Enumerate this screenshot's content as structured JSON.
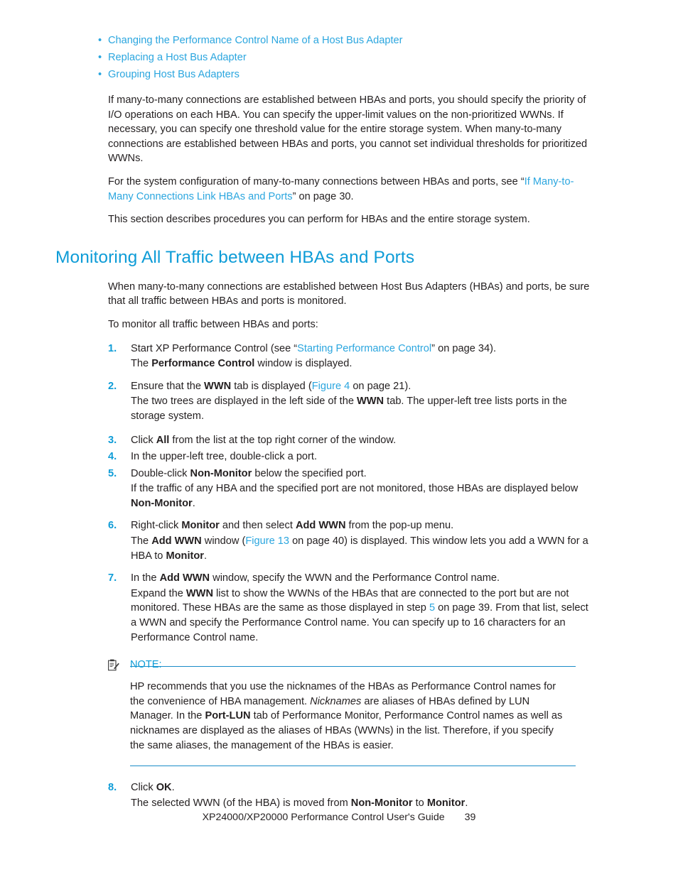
{
  "document": {
    "title": "XP24000/XP20000 Performance Control User's Guide",
    "page_number": "39"
  },
  "colors": {
    "heading_blue": "#0e9cd7",
    "link_blue": "#2ba6df",
    "rule_blue": "#1a8cc8",
    "body_black": "#231f20"
  },
  "top_links": [
    {
      "bullet": "•",
      "label": "Changing the Performance Control Name of a Host Bus Adapter"
    },
    {
      "bullet": "•",
      "label": "Replacing a Host Bus Adapter"
    },
    {
      "bullet": "•",
      "label": "Grouping Host Bus Adapters"
    }
  ],
  "intro": {
    "para1": "If many-to-many connections are established between HBAs and ports, you should specify the priority of I/O operations on each HBA. You can specify the upper-limit values on the non-prioritized WWNs. If necessary, you can specify one threshold value for the entire storage system. When many-to-many connections are established between HBAs and ports, you cannot set individual thresholds for prioritized WWNs.",
    "para2_lead": "For the system configuration of many-to-many connections between HBAs and ports, see",
    "para2_quote_open": "“",
    "para2_link": "If Many-to-Many Connections Link HBAs and Ports",
    "para2_quote_close": "”",
    "para2_tail": " on page 30.",
    "para3": "This section describes procedures you can perform for HBAs and the entire storage system."
  },
  "section": {
    "heading": "Monitoring All Traffic between HBAs and Ports",
    "para1": "When many-to-many connections are established between Host Bus Adapters (HBAs) and ports, be sure that all traffic between HBAs and ports is monitored.",
    "para2": "To monitor all traffic between HBAs and ports:"
  },
  "steps": [
    {
      "num": "1.",
      "main_pre": "Start XP Performance Control (see ",
      "main_quote_open": "“",
      "main_link": "Starting Performance Control",
      "main_quote_close": "”",
      "main_post": " on page 34).",
      "sub_pre": "The ",
      "sub_bold": "Performance Control",
      "sub_post": " window is displayed."
    },
    {
      "num": "2.",
      "main_pre": "Ensure that the ",
      "main_bold": "WWN",
      "main_mid": " tab is displayed (",
      "main_link": "Figure 4",
      "main_post": " on page 21).",
      "sub_pre": "The two trees are displayed in the left side of the ",
      "sub_bold": "WWN",
      "sub_post": " tab. The upper-left tree lists ports in the storage system."
    },
    {
      "num": "3.",
      "main_pre": "Click ",
      "main_bold": "All",
      "main_post": " from the list at the top right corner of the window."
    },
    {
      "num": "4.",
      "main_pre": "In the upper-left tree, double-click a port."
    },
    {
      "num": "5.",
      "main_pre": "Double-click ",
      "main_bold": "Non-Monitor",
      "main_post": " below the specified port.",
      "sub_pre": "If the traffic of any HBA and the specified port are not monitored, those HBAs are displayed below ",
      "sub_bold": "Non-Monitor",
      "sub_post": "."
    },
    {
      "num": "6.",
      "main_pre": "Right-click ",
      "main_bold": "Monitor",
      "main_mid": " and then select ",
      "main_bold2": "Add WWN",
      "main_post": " from the pop-up menu.",
      "sub_pre": "The ",
      "sub_bold": "Add WWN",
      "sub_mid": " window (",
      "sub_link": "Figure 13",
      "sub_mid2": " on page 40) is displayed. This window lets you add a WWN for a HBA to ",
      "sub_bold2": "Monitor",
      "sub_post": "."
    },
    {
      "num": "7.",
      "main_pre": "In the ",
      "main_bold": "Add WWN",
      "main_post": " window, specify the WWN and the Performance Control name.",
      "sub_pre": "Expand the ",
      "sub_bold": "WWN",
      "sub_mid": " list to show the WWNs of the HBAs that are connected to the port but are not monitored. These HBAs are the same as those displayed in step ",
      "sub_link": "5",
      "sub_post": " on page 39. From that list, select a WWN and specify the Performance Control name. You can specify up to 16 characters for an Performance Control name."
    }
  ],
  "note": {
    "icon": "note-clipboard-icon",
    "label": "NOTE:",
    "body_p1": "HP recommends that you use the nicknames of the HBAs as Performance Control names for the convenience of HBA management. ",
    "body_italic": "Nicknames",
    "body_p2": " are aliases of HBAs defined by LUN Manager. In the ",
    "body_bold": "Port-LUN",
    "body_p3": " tab of Performance Monitor, Performance Control names as well as nicknames are displayed as the aliases of HBAs (WWNs) in the list. Therefore, if you specify the same aliases, the management of the HBAs is easier."
  },
  "steps_tail": [
    {
      "num": "8.",
      "main_pre": "Click ",
      "main_bold": "OK",
      "main_post": ".",
      "sub_pre": "The selected WWN (of the HBA) is moved from ",
      "sub_bold": "Non-Monitor",
      "sub_mid": " to ",
      "sub_bold2": "Monitor",
      "sub_post": "."
    }
  ]
}
